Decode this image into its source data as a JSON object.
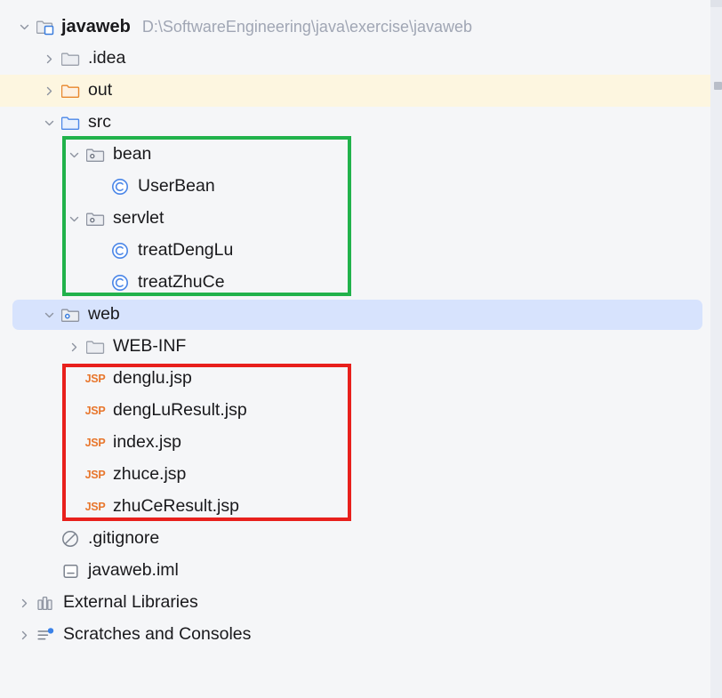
{
  "panel": {
    "name": "project-tree",
    "background": "#f5f6f8",
    "selection_color": "#d7e3fd",
    "warn_row_color": "#fdf6e0"
  },
  "annotations": [
    {
      "name": "green-highlight-box",
      "color": "#21b24b",
      "encloses": "bean, UserBean, servlet, treatDengLu, treatZhuCe"
    },
    {
      "name": "red-highlight-box",
      "color": "#e8201c",
      "encloses": "denglu.jsp, dengLuResult.jsp, index.jsp, zhuce.jsp, zhuCeResult.jsp"
    }
  ],
  "tree": [
    {
      "label": "javaweb",
      "path": "D:\\SoftwareEngineering\\java\\exercise\\javaweb",
      "icon": "module-folder-icon",
      "arrow": "chevron-down",
      "indent": 0,
      "state": "normal"
    },
    {
      "label": ".idea",
      "path": "",
      "icon": "folder-icon",
      "arrow": "chevron-right",
      "indent": 1,
      "state": "normal"
    },
    {
      "label": "out",
      "path": "",
      "icon": "folder-orange-icon",
      "arrow": "chevron-right",
      "indent": 1,
      "state": "warn"
    },
    {
      "label": "src",
      "path": "",
      "icon": "source-folder-icon",
      "arrow": "chevron-down",
      "indent": 1,
      "state": "normal"
    },
    {
      "label": "bean",
      "path": "",
      "icon": "package-icon",
      "arrow": "chevron-down",
      "indent": 2,
      "state": "normal"
    },
    {
      "label": "UserBean",
      "path": "",
      "icon": "java-class-icon",
      "arrow": "none",
      "indent": 3,
      "state": "normal"
    },
    {
      "label": "servlet",
      "path": "",
      "icon": "package-icon",
      "arrow": "chevron-down",
      "indent": 2,
      "state": "normal"
    },
    {
      "label": "treatDengLu",
      "path": "",
      "icon": "java-class-icon",
      "arrow": "none",
      "indent": 3,
      "state": "normal"
    },
    {
      "label": "treatZhuCe",
      "path": "",
      "icon": "java-class-icon",
      "arrow": "none",
      "indent": 3,
      "state": "normal"
    },
    {
      "label": "web",
      "path": "",
      "icon": "web-resource-folder-icon",
      "arrow": "chevron-down",
      "indent": 1,
      "state": "selected"
    },
    {
      "label": "WEB-INF",
      "path": "",
      "icon": "folder-icon",
      "arrow": "chevron-right",
      "indent": 2,
      "state": "normal"
    },
    {
      "label": "denglu.jsp",
      "path": "",
      "icon": "jsp-icon",
      "arrow": "none",
      "indent": 2,
      "state": "normal"
    },
    {
      "label": "dengLuResult.jsp",
      "path": "",
      "icon": "jsp-icon",
      "arrow": "none",
      "indent": 2,
      "state": "normal"
    },
    {
      "label": "index.jsp",
      "path": "",
      "icon": "jsp-icon",
      "arrow": "none",
      "indent": 2,
      "state": "normal"
    },
    {
      "label": "zhuce.jsp",
      "path": "",
      "icon": "jsp-icon",
      "arrow": "none",
      "indent": 2,
      "state": "normal"
    },
    {
      "label": "zhuCeResult.jsp",
      "path": "",
      "icon": "jsp-icon",
      "arrow": "none",
      "indent": 2,
      "state": "normal"
    },
    {
      "label": ".gitignore",
      "path": "",
      "icon": "gitignore-icon",
      "arrow": "none",
      "indent": 1,
      "state": "normal"
    },
    {
      "label": "javaweb.iml",
      "path": "",
      "icon": "iml-file-icon",
      "arrow": "none",
      "indent": 1,
      "state": "normal"
    },
    {
      "label": "External Libraries",
      "path": "",
      "icon": "external-libraries-icon",
      "arrow": "chevron-right",
      "indent": 0,
      "state": "normal"
    },
    {
      "label": "Scratches and Consoles",
      "path": "",
      "icon": "scratches-icon",
      "arrow": "chevron-right",
      "indent": 0,
      "state": "normal"
    }
  ]
}
